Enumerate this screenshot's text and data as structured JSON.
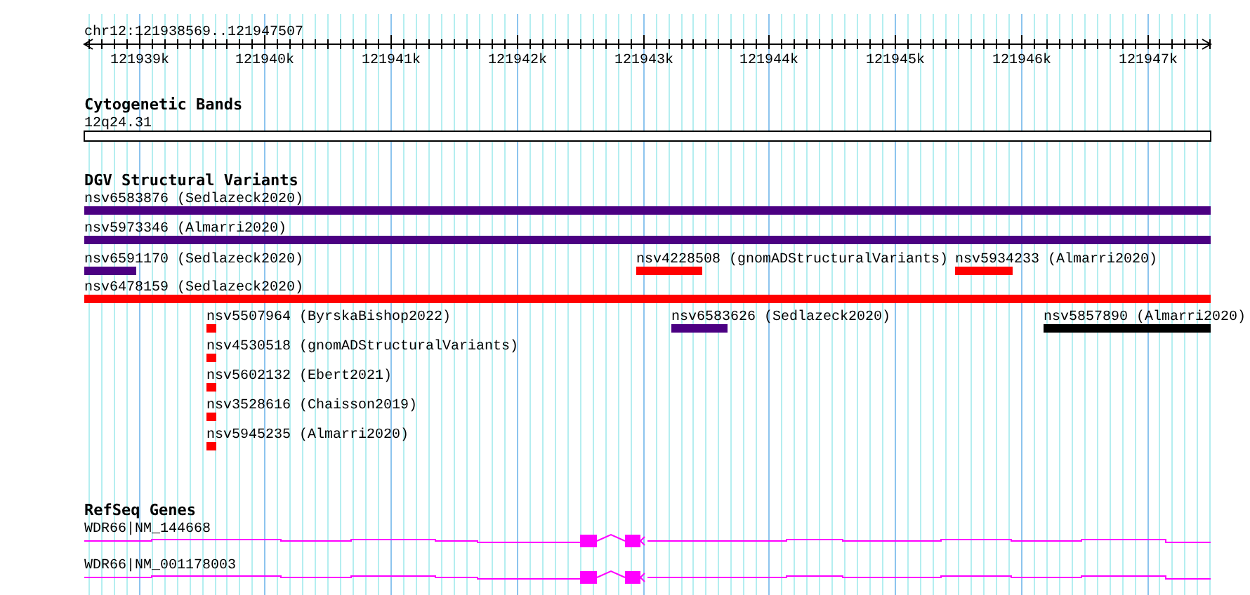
{
  "location": "chr12:121938569..121947507",
  "ruler": {
    "ticks": [
      "121939k",
      "121940k",
      "121941k",
      "121942k",
      "121943k",
      "121944k",
      "121945k",
      "121946k",
      "121947k"
    ]
  },
  "tracks": [
    {
      "kind": "cytoband",
      "title": "Cytogenetic Bands",
      "features": [
        {
          "label": "12q24.31"
        }
      ]
    },
    {
      "kind": "variants",
      "title": "DGV Structural Variants",
      "features": [
        {
          "label": "nsv6583876 (Sedlazeck2020)",
          "color": "#4b0082"
        },
        {
          "label": "nsv5973346 (Almarri2020)",
          "color": "#4b0082"
        },
        {
          "label": "nsv6591170 (Sedlazeck2020)",
          "color": "#4b0082"
        },
        {
          "label": "nsv4228508 (gnomADStructuralVariants)",
          "color": "#ff0000"
        },
        {
          "label": "nsv5934233 (Almarri2020)",
          "color": "#ff0000"
        },
        {
          "label": "nsv6478159 (Sedlazeck2020)",
          "color": "#ff0000"
        },
        {
          "label": "nsv5507964 (ByrskaBishop2022)",
          "color": "#ff0000"
        },
        {
          "label": "nsv6583626 (Sedlazeck2020)",
          "color": "#4b0082"
        },
        {
          "label": "nsv5857890 (Almarri2020)",
          "color": "#000000"
        },
        {
          "label": "nsv4530518 (gnomADStructuralVariants)",
          "color": "#ff0000"
        },
        {
          "label": "nsv5602132 (Ebert2021)",
          "color": "#ff0000"
        },
        {
          "label": "nsv3528616 (Chaisson2019)",
          "color": "#ff0000"
        },
        {
          "label": "nsv5945235 (Almarri2020)",
          "color": "#ff0000"
        }
      ]
    },
    {
      "kind": "genes",
      "title": "RefSeq Genes",
      "features": [
        {
          "label": "WDR66|NM_144668"
        },
        {
          "label": "WDR66|NM_001178003"
        }
      ]
    }
  ]
}
